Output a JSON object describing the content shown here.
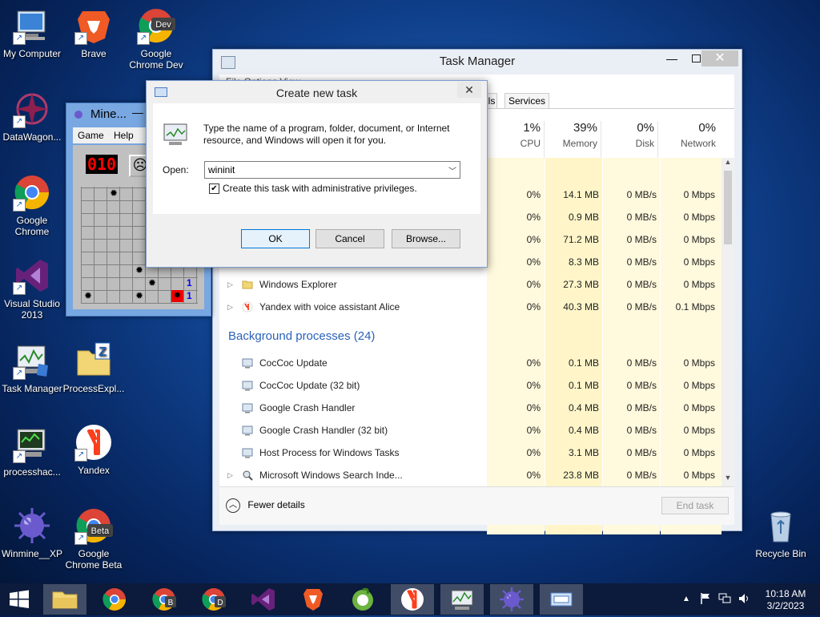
{
  "desktop": {
    "icons": [
      {
        "label": "My Computer"
      },
      {
        "label": "Brave"
      },
      {
        "label": "Google Chrome Dev"
      },
      {
        "label": "DataWagon..."
      },
      {
        "label": "Google Chrome"
      },
      {
        "label": "Visual Studio 2013"
      },
      {
        "label": "Task Manager"
      },
      {
        "label": "ProcessExpl..."
      },
      {
        "label": "processhac..."
      },
      {
        "label": "Yandex"
      },
      {
        "label": "Winmine__XP"
      },
      {
        "label": "Google Chrome Beta"
      },
      {
        "label": "Recycle Bin"
      }
    ]
  },
  "task_manager": {
    "title": "Task Manager",
    "menu_partial": "File  Options  View",
    "tabs": [
      "ils",
      "Services"
    ],
    "columns": [
      {
        "pct": "1%",
        "name": "CPU"
      },
      {
        "pct": "39%",
        "name": "Memory"
      },
      {
        "pct": "0%",
        "name": "Disk"
      },
      {
        "pct": "0%",
        "name": "Network"
      }
    ],
    "app_rows": [
      {
        "cpu": "0%",
        "mem": "14.1 MB",
        "disk": "0 MB/s",
        "net": "0 Mbps"
      },
      {
        "cpu": "0%",
        "mem": "0.9 MB",
        "disk": "0 MB/s",
        "net": "0 Mbps"
      },
      {
        "cpu": "0%",
        "mem": "71.2 MB",
        "disk": "0 MB/s",
        "net": "0 Mbps"
      },
      {
        "cpu": "0%",
        "mem": "8.3 MB",
        "disk": "0 MB/s",
        "net": "0 Mbps"
      },
      {
        "name": "Windows Explorer",
        "cpu": "0%",
        "mem": "27.3 MB",
        "disk": "0 MB/s",
        "net": "0 Mbps"
      },
      {
        "name": "Yandex with voice assistant Alice",
        "cpu": "0%",
        "mem": "40.3 MB",
        "disk": "0 MB/s",
        "net": "0.1 Mbps"
      }
    ],
    "bg_header": "Background processes (24)",
    "bg_rows": [
      {
        "name": "CocCoc Update",
        "cpu": "0%",
        "mem": "0.1 MB",
        "disk": "0 MB/s",
        "net": "0 Mbps"
      },
      {
        "name": "CocCoc Update (32 bit)",
        "cpu": "0%",
        "mem": "0.1 MB",
        "disk": "0 MB/s",
        "net": "0 Mbps"
      },
      {
        "name": "Google Crash Handler",
        "cpu": "0%",
        "mem": "0.4 MB",
        "disk": "0 MB/s",
        "net": "0 Mbps"
      },
      {
        "name": "Google Crash Handler (32 bit)",
        "cpu": "0%",
        "mem": "0.4 MB",
        "disk": "0 MB/s",
        "net": "0 Mbps"
      },
      {
        "name": "Host Process for Windows Tasks",
        "cpu": "0%",
        "mem": "3.1 MB",
        "disk": "0 MB/s",
        "net": "0 Mbps"
      },
      {
        "name": "Microsoft Windows Search Inde...",
        "cpu": "0%",
        "mem": "23.8 MB",
        "disk": "0 MB/s",
        "net": "0 Mbps"
      }
    ],
    "fewer_details": "Fewer details",
    "end_task": "End task"
  },
  "minesweeper": {
    "title": "Mine...",
    "menu": [
      "Game",
      "Help"
    ],
    "counter": "010",
    "face": "☹"
  },
  "dialog": {
    "title": "Create new task",
    "description": "Type the name of a program, folder, document, or Internet resource, and Windows will open it for you.",
    "open_label": "Open:",
    "open_value": "wininit",
    "admin_label": "Create this task with administrative privileges.",
    "ok": "OK",
    "cancel": "Cancel",
    "browse": "Browse..."
  },
  "taskbar": {
    "time": "10:18 AM",
    "date": "3/2/2023"
  },
  "colors": {
    "accent": "#1a5fb4",
    "heat": "#fff5c9",
    "section": "#2a62b8"
  }
}
